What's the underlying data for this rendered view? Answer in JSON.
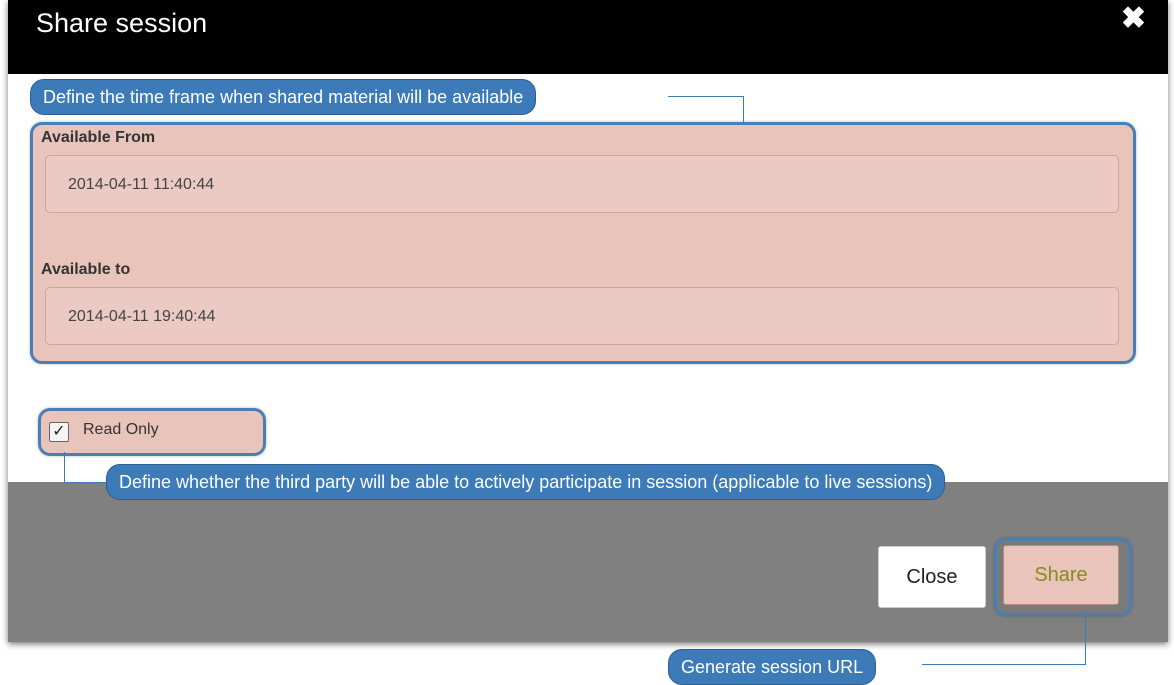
{
  "dialog": {
    "title": "Share session",
    "close_icon": "close-icon"
  },
  "callouts": {
    "time_frame": "Define the time frame when shared material will be available",
    "read_only": "Define whether the third party will be able to actively participate in session (applicable to live sessions)",
    "share": "Generate session URL"
  },
  "form": {
    "available_from_label": "Available From",
    "available_from_value": "2014-04-11 11:40:44",
    "available_to_label": "Available to",
    "available_to_value": "2014-04-11 19:40:44",
    "read_only_label": "Read Only",
    "read_only_checked": true
  },
  "footer": {
    "close_label": "Close",
    "share_label": "Share"
  },
  "colors": {
    "callout": "#3d7ab8",
    "highlight": "#e8c4bb",
    "share_text": "#8a8a1e"
  }
}
